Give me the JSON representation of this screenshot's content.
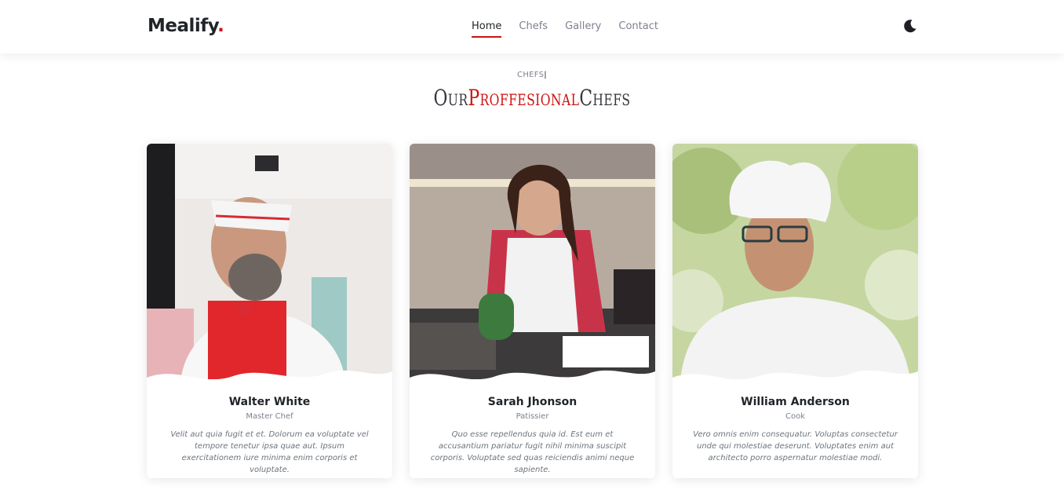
{
  "header": {
    "logo": "Mealify",
    "logo_dot": ".",
    "nav": [
      "Home",
      "Chefs",
      "Gallery",
      "Contact"
    ],
    "active_nav": "Home",
    "theme_icon": "moon-icon"
  },
  "section": {
    "subtitle": "CHEFS",
    "title_part1": "Our",
    "title_part2": "Proffesional",
    "title_part3": "Chefs"
  },
  "chefs": [
    {
      "name": "Walter White",
      "role": "Master Chef",
      "bio": "Velit aut quia fugit et et. Dolorum ea voluptate vel tempore tenetur ipsa quae aut. Ipsum exercitationem iure minima enim corporis et voluptate."
    },
    {
      "name": "Sarah Jhonson",
      "role": "Patissier",
      "bio": "Quo esse repellendus quia id. Est eum et accusantium pariatur fugit nihil minima suscipit corporis. Voluptate sed quas reiciendis animi neque sapiente."
    },
    {
      "name": "William Anderson",
      "role": "Cook",
      "bio": "Vero omnis enim consequatur. Voluptas consectetur unde qui molestiae deserunt. Voluptates enim aut architecto porro aspernatur molestiae modi."
    }
  ],
  "colors": {
    "accent": "#ce1212",
    "text": "#212529",
    "muted": "#7f7f90"
  }
}
